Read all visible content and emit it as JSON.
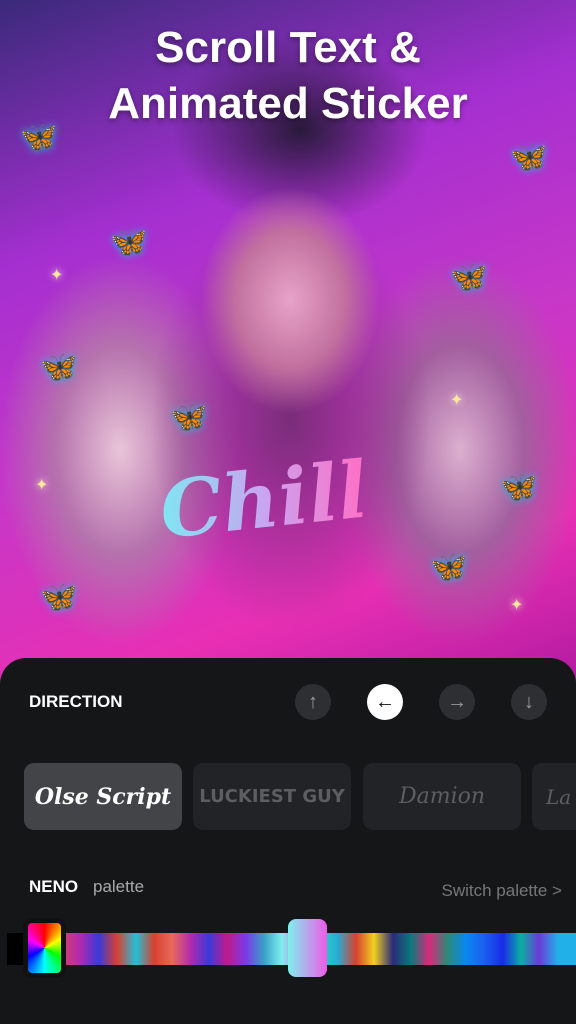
{
  "promo": {
    "title_line1": "Scroll Text &",
    "title_line2": "Animated Sticker",
    "sticker_text": "Chill"
  },
  "direction": {
    "label": "DIRECTION",
    "buttons": [
      {
        "name": "up",
        "glyph": "↑",
        "active": false
      },
      {
        "name": "left",
        "glyph": "←",
        "active": true
      },
      {
        "name": "right",
        "glyph": "→",
        "active": false
      },
      {
        "name": "down",
        "glyph": "↓",
        "active": false
      }
    ]
  },
  "fonts": [
    {
      "label": "Olse Script",
      "selected": true
    },
    {
      "label": "LUCKIEST GUY",
      "selected": false
    },
    {
      "label": "Damion",
      "selected": false
    },
    {
      "label": "La",
      "selected": false
    }
  ],
  "palette": {
    "name": "NENO",
    "suffix": "palette",
    "switch_label": "Switch palette >",
    "swatches": [
      "#000000",
      "#000000",
      "#7a2bd0",
      "#d8406a",
      "#b02ab0",
      "#3a3ad8",
      "#d84030",
      "#22c0d8",
      "#d84030",
      "#e86a5a",
      "#b02ab0",
      "#3a3ad8",
      "#c01a8a",
      "#7a3ae8",
      "#3aa0c8",
      "#7ff0ee",
      "#f05ae8",
      "#3ad0b8",
      "#22b0d8",
      "#d84030",
      "#f0d020",
      "#2a2a7a",
      "#0a7a7a",
      "#d82a7a",
      "#2a8a7a",
      "#0a88f0",
      "#1a60f0",
      "#1a2ae8",
      "#0ab0a0",
      "#6a3ad8",
      "#22b0e8"
    ]
  }
}
